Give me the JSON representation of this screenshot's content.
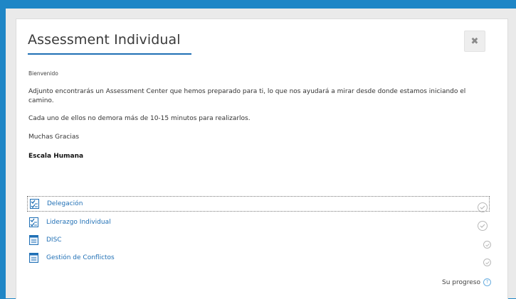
{
  "modal": {
    "title": "Assessment Individual",
    "close_label": "✖",
    "greeting": "Bienvenido",
    "paragraphs": [
      "Adjunto encontrarás un Assessment Center que hemos preparado para ti, lo que nos ayudará a mirar desde donde estamos iniciando el camino.",
      "Cada uno de ellos no demora más de 10-15 minutos para realizarlos.",
      "Muchas Gracias",
      "Escala Humana"
    ],
    "activities": [
      {
        "label": "Delegación",
        "icon": "quiz-icon"
      },
      {
        "label": "Liderazgo Individual",
        "icon": "quiz-icon"
      },
      {
        "label": "DISC",
        "icon": "page-icon"
      },
      {
        "label": "Gestión de Conflictos",
        "icon": "page-icon"
      }
    ],
    "progress_label": "Su progreso",
    "help_glyph": "?"
  },
  "colors": {
    "accent": "#1f86c6",
    "link": "#1f6fb5"
  }
}
